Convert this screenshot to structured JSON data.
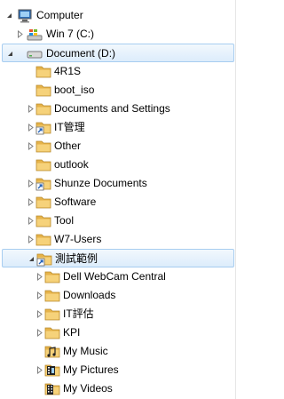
{
  "tree": {
    "nodes": [
      {
        "label": "Computer",
        "icon": "computer-icon",
        "expander": "expanded",
        "selected": false
      },
      {
        "label": "Win 7 (C:)",
        "icon": "windows-drive-icon",
        "expander": "collapsed",
        "selected": false
      },
      {
        "label": "Document (D:)",
        "icon": "drive-icon",
        "expander": "expanded",
        "selected": true
      },
      {
        "label": "4R1S",
        "icon": "folder-icon",
        "expander": "none",
        "selected": false
      },
      {
        "label": "boot_iso",
        "icon": "folder-icon",
        "expander": "none",
        "selected": false
      },
      {
        "label": "Documents and Settings",
        "icon": "folder-icon",
        "expander": "collapsed",
        "selected": false
      },
      {
        "label": "IT管理",
        "icon": "folder-shortcut-icon",
        "expander": "collapsed",
        "selected": false
      },
      {
        "label": "Other",
        "icon": "folder-icon",
        "expander": "collapsed",
        "selected": false
      },
      {
        "label": "outlook",
        "icon": "folder-icon",
        "expander": "none",
        "selected": false
      },
      {
        "label": "Shunze Documents",
        "icon": "folder-shortcut-icon",
        "expander": "collapsed",
        "selected": false
      },
      {
        "label": "Software",
        "icon": "folder-icon",
        "expander": "collapsed",
        "selected": false
      },
      {
        "label": "Tool",
        "icon": "folder-icon",
        "expander": "collapsed",
        "selected": false
      },
      {
        "label": "W7-Users",
        "icon": "folder-icon",
        "expander": "collapsed",
        "selected": false
      },
      {
        "label": "測試範例",
        "icon": "folder-shortcut-icon",
        "expander": "expanded",
        "selected": true
      },
      {
        "label": "Dell WebCam Central",
        "icon": "folder-icon",
        "expander": "collapsed",
        "selected": false
      },
      {
        "label": "Downloads",
        "icon": "folder-icon",
        "expander": "collapsed",
        "selected": false
      },
      {
        "label": "IT評估",
        "icon": "folder-icon",
        "expander": "collapsed",
        "selected": false
      },
      {
        "label": "KPI",
        "icon": "folder-icon",
        "expander": "collapsed",
        "selected": false
      },
      {
        "label": "My Music",
        "icon": "music-folder-icon",
        "expander": "none",
        "selected": false
      },
      {
        "label": "My Pictures",
        "icon": "pictures-folder-icon",
        "expander": "collapsed",
        "selected": false
      },
      {
        "label": "My Videos",
        "icon": "videos-folder-icon",
        "expander": "none",
        "selected": false
      }
    ]
  },
  "colors": {
    "selection_fill": "#dcecfb",
    "selection_border": "#a7cdf0",
    "folder": "#f3cd6c",
    "arrow_collapsed": "#7f7f7f",
    "arrow_expanded": "#404040"
  }
}
